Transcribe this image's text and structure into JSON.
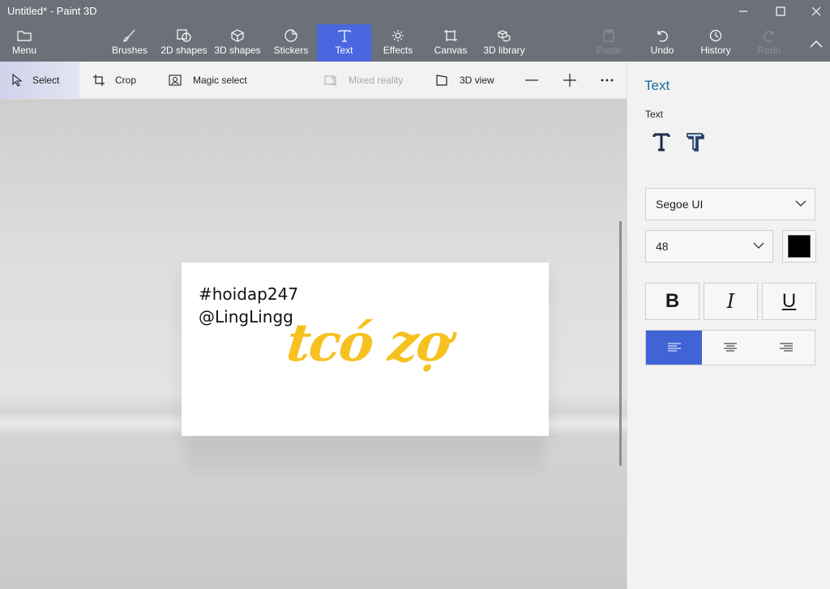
{
  "window": {
    "title": "Untitled* - Paint 3D"
  },
  "ribbon": {
    "menu": "Menu",
    "brushes": "Brushes",
    "shapes_2d": "2D shapes",
    "shapes_3d": "3D shapes",
    "stickers": "Stickers",
    "text": "Text",
    "effects": "Effects",
    "canvas": "Canvas",
    "library_3d": "3D library",
    "paste": "Paste",
    "undo": "Undo",
    "history": "History",
    "redo": "Redo"
  },
  "toolbar": {
    "select": "Select",
    "crop": "Crop",
    "magic_select": "Magic select",
    "mixed_reality": "Mixed reality",
    "view_3d": "3D view"
  },
  "canvas": {
    "line1": "#hoidap247",
    "line2": "@LingLingg",
    "handwriting": "tcó zợ"
  },
  "panel": {
    "title": "Text",
    "subtitle": "Text",
    "font": "Segoe UI",
    "size": "48",
    "color": "#000000",
    "bold": "B",
    "italic": "I",
    "underline": "U"
  },
  "colors": {
    "ribbon_bg": "#6c7078",
    "active_tab": "#4a67e0",
    "panel_title": "#1a6ba0",
    "handwriting": "#f7c11f",
    "align_active": "#4064d6"
  }
}
